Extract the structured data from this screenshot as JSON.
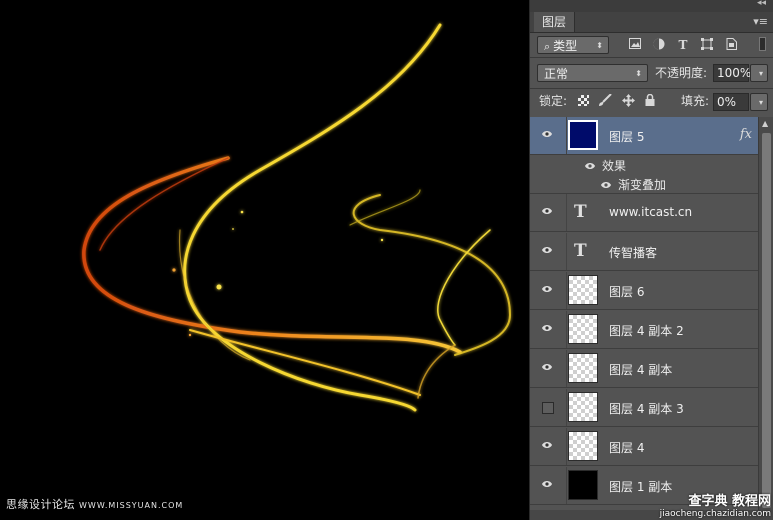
{
  "panel": {
    "tab_label": "图层",
    "filter": {
      "label": "类型"
    },
    "blend_mode": "正常",
    "opacity": {
      "label": "不透明度:",
      "value": "100%"
    },
    "lock": {
      "label": "锁定:"
    },
    "fill": {
      "label": "填充:",
      "value": "0%"
    }
  },
  "layers": [
    {
      "name": "图层 5",
      "visible": true,
      "selected": true,
      "thumb": "navy",
      "has_fx": true,
      "fx_label": "fx"
    },
    {
      "name": "www.itcast.cn",
      "visible": true,
      "thumb": "text"
    },
    {
      "name": "传智播客",
      "visible": true,
      "thumb": "text"
    },
    {
      "name": "图层 6",
      "visible": true,
      "thumb": "transparent"
    },
    {
      "name": "图层 4 副本 2",
      "visible": true,
      "thumb": "transparent"
    },
    {
      "name": "图层 4 副本",
      "visible": true,
      "thumb": "transparent"
    },
    {
      "name": "图层 4 副本 3",
      "visible": false,
      "thumb": "transparent"
    },
    {
      "name": "图层 4",
      "visible": true,
      "thumb": "transparent"
    },
    {
      "name": "图层 1 副本",
      "visible": true,
      "thumb": "black"
    }
  ],
  "effects": {
    "label": "效果",
    "item": "渐变叠加"
  },
  "text_thumb_glyph": "T",
  "watermarks": {
    "left": "思缘设计论坛",
    "left_url": "WWW.MISSYUAN.COM",
    "right_big": "查字典 教程网",
    "right_small": "jiaocheng.chazidian.com"
  },
  "colors": {
    "selected_row": "#5a6e8c",
    "layer5_fill": "#000b6a",
    "glow_yellow": "#f5e23a",
    "glow_orange": "#f08a1e"
  }
}
